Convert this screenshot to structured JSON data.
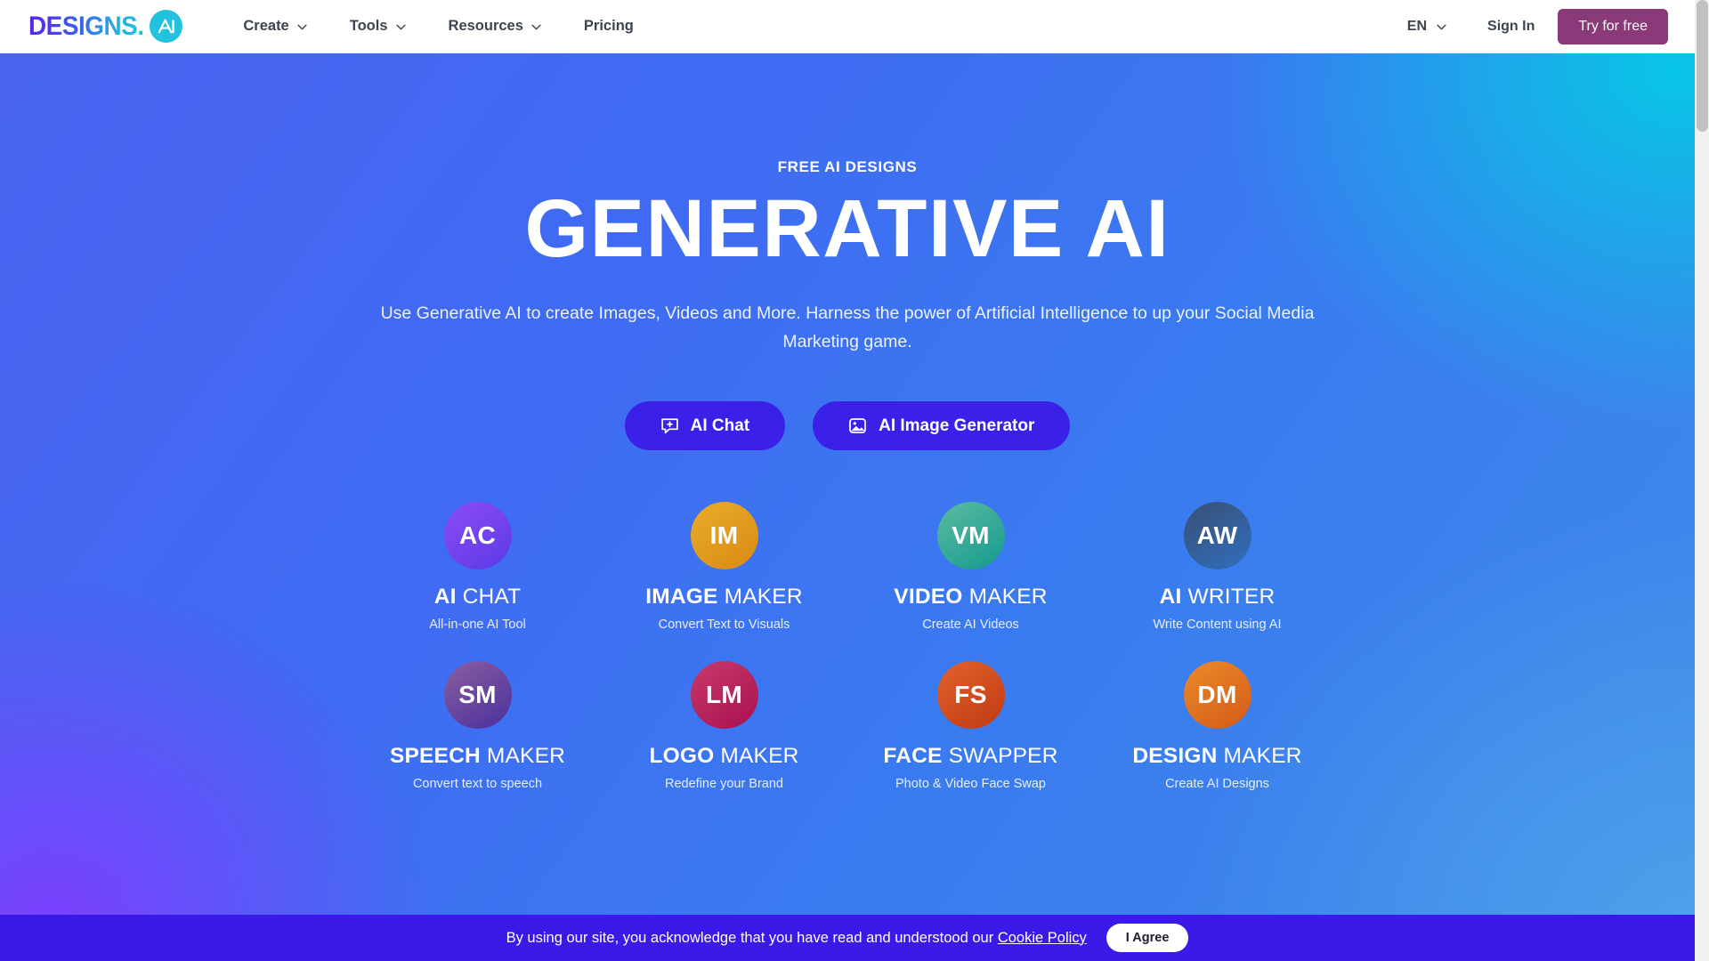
{
  "nav": {
    "logo_word": "DESIGNS.",
    "logo_badge_alt": "AI",
    "links": [
      {
        "label": "Create",
        "has_chevron": true
      },
      {
        "label": "Tools",
        "has_chevron": true
      },
      {
        "label": "Resources",
        "has_chevron": true
      },
      {
        "label": "Pricing",
        "has_chevron": false
      }
    ],
    "language": "EN",
    "sign_in": "Sign In",
    "try_free": "Try for free"
  },
  "hero": {
    "eyebrow": "FREE AI DESIGNS",
    "headline": "GENERATIVE AI",
    "subtitle": "Use Generative AI to create Images, Videos and More. Harness the power of Artificial Intelligence to up your Social Media Marketing game.",
    "cta": [
      {
        "label": "AI Chat",
        "icon": "chat-plus-icon"
      },
      {
        "label": "AI Image Generator",
        "icon": "image-icon"
      }
    ]
  },
  "tools": [
    {
      "initials": "AC",
      "title_bold": "AI",
      "title_light": "CHAT",
      "subtitle": "All-in-one AI Tool",
      "color_from": "#8d4bf5",
      "color_to": "#5b3ae8"
    },
    {
      "initials": "IM",
      "title_bold": "IMAGE",
      "title_light": "MAKER",
      "subtitle": "Convert Text to Visuals",
      "color_from": "#e8ad2a",
      "color_to": "#d98a14"
    },
    {
      "initials": "VM",
      "title_bold": "VIDEO",
      "title_light": "MAKER",
      "subtitle": "Create AI Videos",
      "color_from": "#5dbba0",
      "color_to": "#139a8e"
    },
    {
      "initials": "AW",
      "title_bold": "AI",
      "title_light": "WRITER",
      "subtitle": "Write Content using AI",
      "color_from": "#3a4f72",
      "color_to": "#2f6fc2"
    },
    {
      "initials": "SM",
      "title_bold": "SPEECH",
      "title_light": "MAKER",
      "subtitle": "Convert text to speech",
      "color_from": "#8a5f9e",
      "color_to": "#4a2f9e"
    },
    {
      "initials": "LM",
      "title_bold": "LOGO",
      "title_light": "MAKER",
      "subtitle": "Redefine your Brand",
      "color_from": "#c93a6a",
      "color_to": "#a8104f"
    },
    {
      "initials": "FS",
      "title_bold": "FACE",
      "title_light": "SWAPPER",
      "subtitle": "Photo & Video Face Swap",
      "color_from": "#e2622a",
      "color_to": "#c03a14"
    },
    {
      "initials": "DM",
      "title_bold": "DESIGN",
      "title_light": "MAKER",
      "subtitle": "Create AI Designs",
      "color_from": "#ec8a2a",
      "color_to": "#d45a18"
    }
  ],
  "cookie": {
    "text": "By using our site, you acknowledge that you have read and understood our",
    "link": "Cookie Policy",
    "agree": "I Agree"
  }
}
